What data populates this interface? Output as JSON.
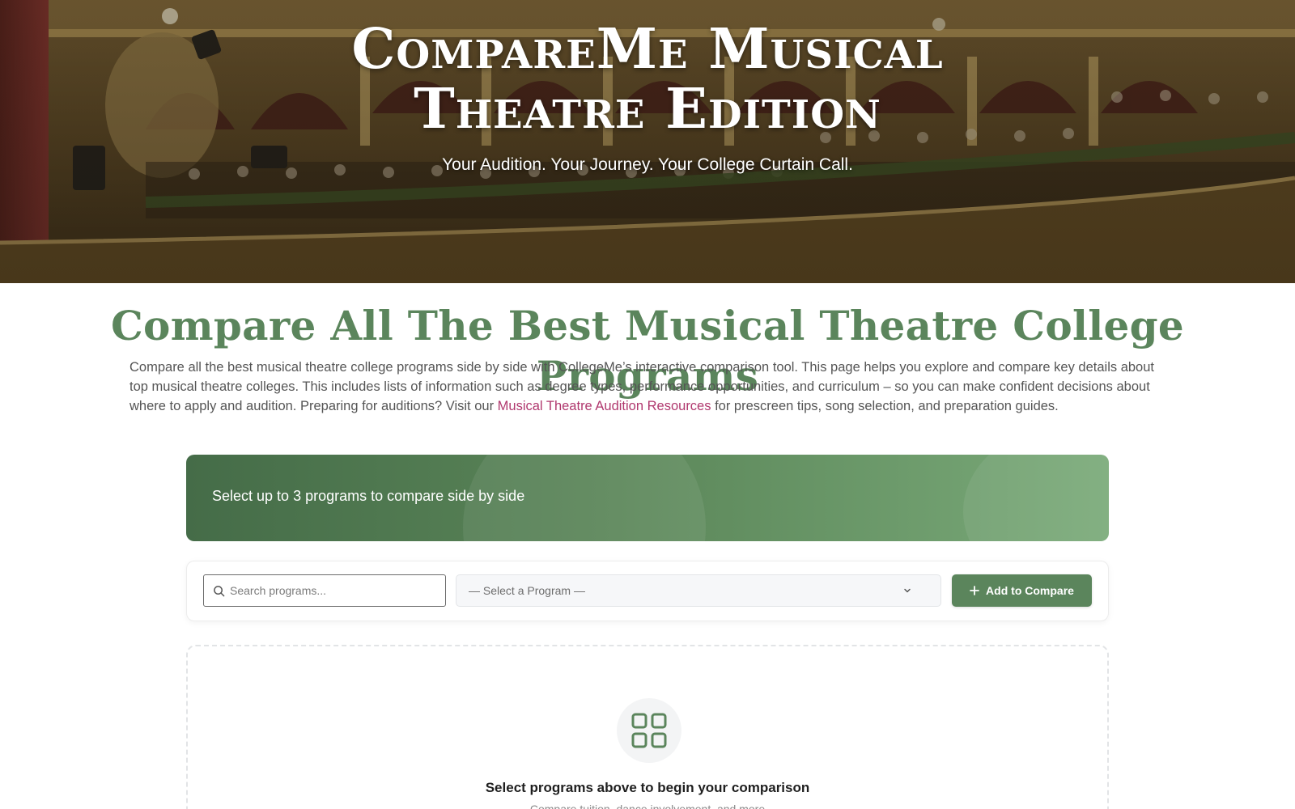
{
  "hero": {
    "title_line1": "CompareMe Musical",
    "title_line2": "Theatre Edition",
    "tagline": "Your Audition. Your Journey. Your College Curtain Call."
  },
  "intro": {
    "heading": "Compare All The Best Musical Theatre College Programs",
    "body_before_link": "Compare all the best musical theatre college programs side by side with CollegeMe’s interactive comparison tool. This page helps you explore and compare key details about top musical theatre colleges. This includes lists of information such as degree types, performance opportunities, and curriculum – so you can make confident decisions about where to apply and audition. Preparing for auditions? Visit our ",
    "link_text": "Musical Theatre Audition Resources",
    "body_after_link": " for prescreen tips, song selection, and preparation guides."
  },
  "banner": {
    "text": "Select up to 3 programs to compare side by side"
  },
  "toolbar": {
    "search_placeholder": "Search programs...",
    "search_icon": "search-icon",
    "select_value": "— Select a Program —",
    "select_icon": "chevron-down-icon",
    "add_icon": "plus-icon",
    "add_label": "Add to Compare"
  },
  "empty_state": {
    "icon": "grid-icon",
    "title": "Select programs above to begin your comparison",
    "subtitle": "Compare tuition, dance involvement, and more"
  },
  "colors": {
    "accent_green": "#5b855c",
    "link_pink": "#b0386e",
    "banner_gradient_start": "#456c48",
    "banner_gradient_end": "#7aaa79"
  }
}
